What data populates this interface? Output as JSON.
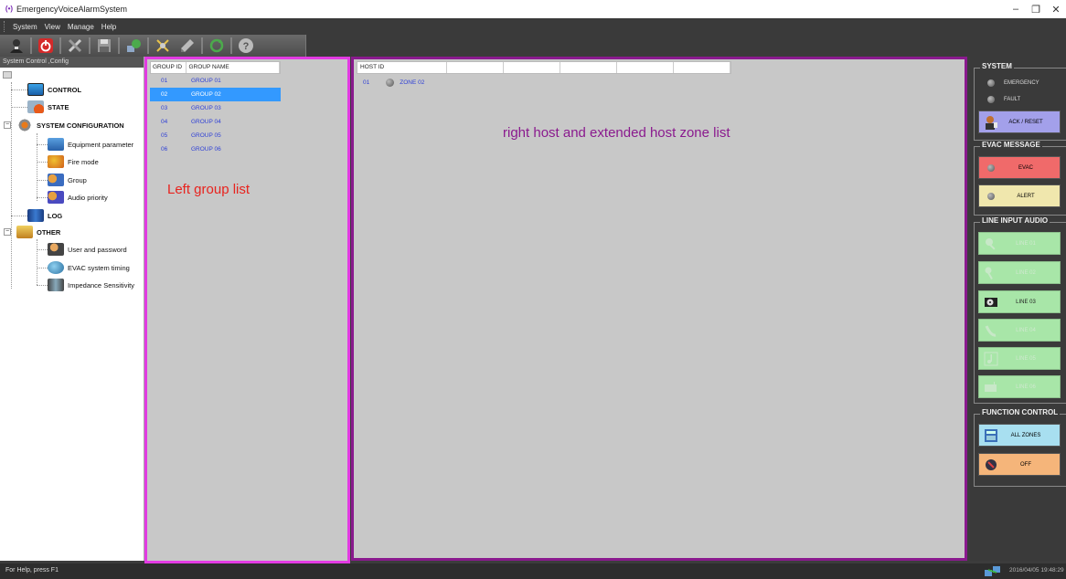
{
  "window": {
    "title": "EmergencyVoiceAlarmSystem",
    "controls": [
      "–",
      "❐",
      "✕"
    ]
  },
  "menu": [
    "System",
    "View",
    "Manage",
    "Help"
  ],
  "toolbar": {
    "icons": [
      "user-icon",
      "power-icon",
      "tools-icon",
      "save-icon",
      "network-icon",
      "settings-icon",
      "pen-icon",
      "refresh-icon",
      "help-icon"
    ]
  },
  "tree": {
    "header": "System Control ,Config",
    "items": [
      {
        "label": "CONTROL",
        "icon": "monitor-icon"
      },
      {
        "label": "STATE",
        "icon": "state-icon"
      },
      {
        "label": "SYSTEM CONFIGURATION",
        "icon": "gear-icon"
      },
      {
        "label": "Equipment parameter",
        "icon": "equipment-icon"
      },
      {
        "label": "Fire mode",
        "icon": "fire-icon"
      },
      {
        "label": "Group",
        "icon": "group-icon"
      },
      {
        "label": "Audio priority",
        "icon": "audio-priority-icon"
      },
      {
        "label": "LOG",
        "icon": "log-icon"
      },
      {
        "label": "OTHER",
        "icon": "other-icon"
      },
      {
        "label": "User and password",
        "icon": "user-password-icon"
      },
      {
        "label": "EVAC system timing",
        "icon": "globe-timing-icon"
      },
      {
        "label": "Impedance Sensitivity",
        "icon": "impedance-icon"
      }
    ]
  },
  "groups": {
    "headers": [
      "GROUP ID",
      "GROUP NAME"
    ],
    "rows": [
      {
        "id": "01",
        "name": "GROUP 01"
      },
      {
        "id": "02",
        "name": "GROUP 02"
      },
      {
        "id": "03",
        "name": "GROUP 03"
      },
      {
        "id": "04",
        "name": "GROUP 04"
      },
      {
        "id": "05",
        "name": "GROUP 05"
      },
      {
        "id": "06",
        "name": "GROUP 06"
      }
    ],
    "selected_index": 1,
    "annotation": "Left group list"
  },
  "zones": {
    "header": "HOST ID",
    "rows": [
      {
        "host_id": "01",
        "zone": "ZONE 02"
      }
    ],
    "annotation": "right host and extended host zone list"
  },
  "right": {
    "system": {
      "title": "SYSTEM",
      "emergency": "EMERGENCY",
      "fault": "FAULT",
      "ack": "ACK / RESET"
    },
    "evac": {
      "title": "EVAC MESSAGE",
      "evac": "EVAC",
      "alert": "ALERT"
    },
    "line": {
      "title": "LINE INPUT AUDIO",
      "items": [
        "LINE 01",
        "LINE 02",
        "LINE 03",
        "LINE 04",
        "LINE 05",
        "LINE 06"
      ]
    },
    "func": {
      "title": "FUNCTION CONTROL",
      "all": "ALL ZONES",
      "off": "OFF"
    }
  },
  "status": {
    "help": "For Help, press F1",
    "datetime": "2016/04/05 19:48:29"
  },
  "colors": {
    "group_border": "#e23be2",
    "zone_border": "#8a1a8e",
    "selection": "#3399ff",
    "evac": "#f06a6a",
    "alert": "#f0e7ad",
    "line_active": "#a8e6a8",
    "all_zones": "#a8dff0",
    "off": "#f5b57a",
    "ack": "#a3a0ea"
  }
}
